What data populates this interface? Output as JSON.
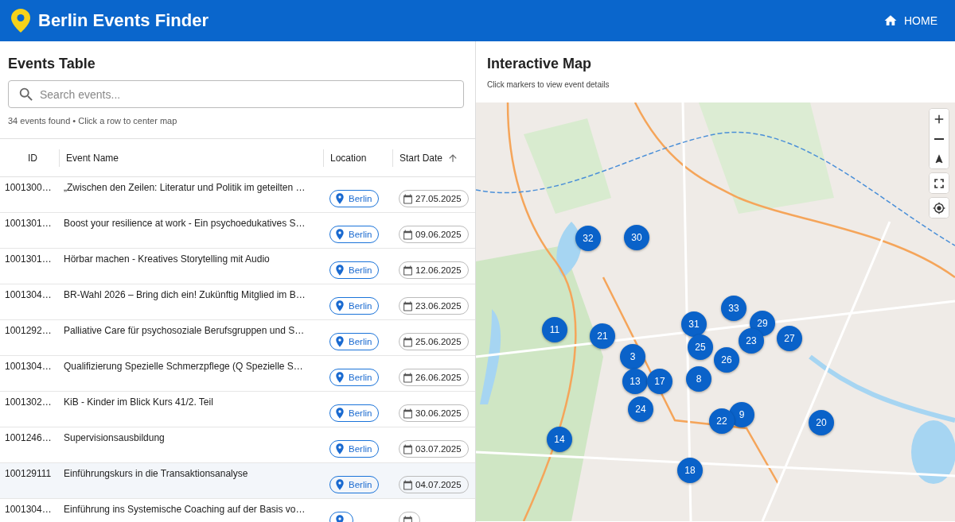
{
  "app_bar": {
    "title": "Berlin Events Finder",
    "nav": [
      {
        "label": "HOME"
      }
    ]
  },
  "events_table": {
    "title": "Events Table",
    "search": {
      "placeholder": "Search events..."
    },
    "summary": "34 events found • Click a row to center map",
    "columns": [
      {
        "label": "ID",
        "sorted": false
      },
      {
        "label": "Event Name",
        "sorted": false
      },
      {
        "label": "Location",
        "sorted": false
      },
      {
        "label": "Start Date",
        "sorted": true
      }
    ],
    "rows": [
      {
        "id": "1001300…",
        "name": "„Zwischen den Zeilen: Literatur und Politik im geteilten …",
        "location": "Berlin",
        "start_date": "27.05.2025",
        "selected": false
      },
      {
        "id": "1001301…",
        "name": "Boost your resilience at work - Ein psychoedukatives S…",
        "location": "Berlin",
        "start_date": "09.06.2025",
        "selected": false
      },
      {
        "id": "1001301…",
        "name": "Hörbar machen - Kreatives Storytelling mit Audio",
        "location": "Berlin",
        "start_date": "12.06.2025",
        "selected": false
      },
      {
        "id": "1001304…",
        "name": "BR-Wahl 2026 – Bring dich ein! Zukünftig Mitglied im B…",
        "location": "Berlin",
        "start_date": "23.06.2025",
        "selected": false
      },
      {
        "id": "1001292…",
        "name": "Palliative Care für psychosoziale Berufsgruppen und S…",
        "location": "Berlin",
        "start_date": "25.06.2025",
        "selected": false
      },
      {
        "id": "1001304…",
        "name": "Qualifizierung Spezielle Schmerzpflege (Q Spezielle S…",
        "location": "Berlin",
        "start_date": "26.06.2025",
        "selected": false
      },
      {
        "id": "1001302…",
        "name": "KiB - Kinder im Blick Kurs 41/2. Teil",
        "location": "Berlin",
        "start_date": "30.06.2025",
        "selected": false
      },
      {
        "id": "1001246…",
        "name": "Supervisionsausbildung",
        "location": "Berlin",
        "start_date": "03.07.2025",
        "selected": false
      },
      {
        "id": "100129111",
        "name": "Einführungskurs in die Transaktionsanalyse",
        "location": "Berlin",
        "start_date": "04.07.2025",
        "selected": true
      },
      {
        "id": "1001304…",
        "name": "Einführung ins Systemische Coaching auf der Basis vo…",
        "selected": false
      }
    ]
  },
  "map": {
    "title": "Interactive Map",
    "subtitle": "Click markers to view event details",
    "markers": [
      {
        "label": "32"
      },
      {
        "label": "30"
      },
      {
        "label": "33"
      },
      {
        "label": "29"
      },
      {
        "label": "31"
      },
      {
        "label": "11"
      },
      {
        "label": "21"
      },
      {
        "label": "23"
      },
      {
        "label": "27"
      },
      {
        "label": "25"
      },
      {
        "label": "3"
      },
      {
        "label": "26"
      },
      {
        "label": "13"
      },
      {
        "label": "17"
      },
      {
        "label": "8"
      },
      {
        "label": "24"
      },
      {
        "label": "9"
      },
      {
        "label": "22"
      },
      {
        "label": "20"
      },
      {
        "label": "14"
      },
      {
        "label": "18"
      }
    ]
  }
}
